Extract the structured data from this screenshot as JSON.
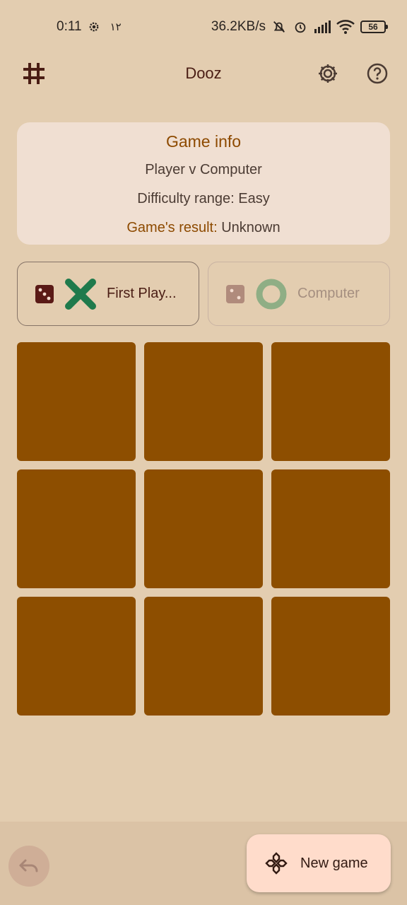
{
  "status_bar": {
    "time": "0:11",
    "extra": "۱۲",
    "net_speed": "36.2KB/s",
    "battery": "56"
  },
  "app_bar": {
    "title": "Dooz"
  },
  "game_info": {
    "title": "Game info",
    "mode": "Player v Computer",
    "difficulty": "Difficulty range: Easy",
    "result_label": "Game's result:",
    "result_value": "Unknown"
  },
  "players": [
    {
      "name": "First Play...",
      "symbol": "X",
      "active": true
    },
    {
      "name": "Computer",
      "symbol": "O",
      "active": false
    }
  ],
  "board": {
    "cells": [
      "",
      "",
      "",
      "",
      "",
      "",
      "",
      "",
      ""
    ]
  },
  "actions": {
    "new_game": "New game"
  },
  "colors": {
    "background": "#e3cdb0",
    "cell": "#8d4e00",
    "accent": "#8d4a00",
    "x_mark": "#1f7a4c",
    "o_mark": "#8fae85"
  }
}
